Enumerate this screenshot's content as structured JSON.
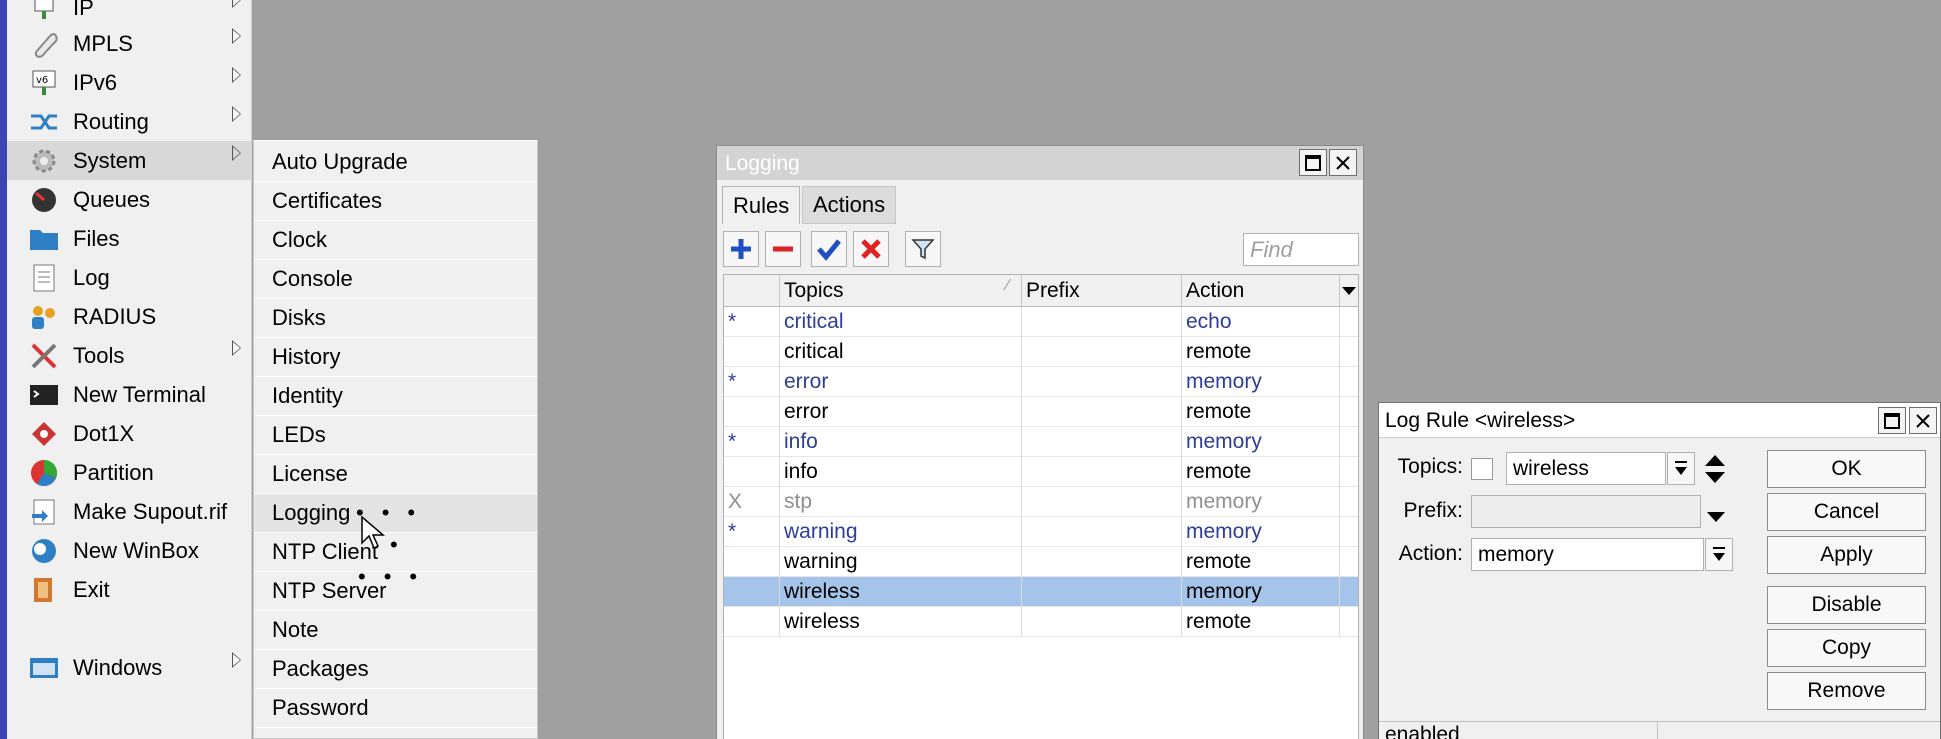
{
  "main_menu": {
    "items": [
      {
        "label": "IP",
        "icon": "ip-icon",
        "submenu": true
      },
      {
        "label": "MPLS",
        "icon": "mpls-icon",
        "submenu": true
      },
      {
        "label": "IPv6",
        "icon": "ipv6-icon",
        "submenu": true
      },
      {
        "label": "Routing",
        "icon": "routing-icon",
        "submenu": true
      },
      {
        "label": "System",
        "icon": "gear-icon",
        "submenu": true,
        "active": true
      },
      {
        "label": "Queues",
        "icon": "queues-icon",
        "submenu": false
      },
      {
        "label": "Files",
        "icon": "folder-icon",
        "submenu": false
      },
      {
        "label": "Log",
        "icon": "log-icon",
        "submenu": false
      },
      {
        "label": "RADIUS",
        "icon": "radius-icon",
        "submenu": false
      },
      {
        "label": "Tools",
        "icon": "tools-icon",
        "submenu": true
      },
      {
        "label": "New Terminal",
        "icon": "terminal-icon",
        "submenu": false
      },
      {
        "label": "Dot1X",
        "icon": "dot1x-icon",
        "submenu": false
      },
      {
        "label": "Partition",
        "icon": "partition-icon",
        "submenu": false
      },
      {
        "label": "Make Supout.rif",
        "icon": "supout-icon",
        "submenu": false
      },
      {
        "label": "New WinBox",
        "icon": "winbox-icon",
        "submenu": false
      },
      {
        "label": "Exit",
        "icon": "exit-icon",
        "submenu": false
      },
      {
        "label": "Windows",
        "icon": "windows-icon",
        "submenu": true
      }
    ]
  },
  "system_submenu": {
    "items": [
      "Auto Upgrade",
      "Certificates",
      "Clock",
      "Console",
      "Disks",
      "History",
      "Identity",
      "LEDs",
      "License",
      "Logging",
      "NTP Client",
      "NTP Server",
      "Note",
      "Packages",
      "Password"
    ],
    "active": "Logging"
  },
  "logging_window": {
    "title": "Logging",
    "tabs": [
      "Rules",
      "Actions"
    ],
    "find_placeholder": "Find",
    "columns": [
      "Topics",
      "Prefix",
      "Action"
    ],
    "rows": [
      {
        "flag": "*",
        "topics": "critical",
        "prefix": "",
        "action": "echo",
        "style": "default"
      },
      {
        "flag": "",
        "topics": "critical",
        "prefix": "",
        "action": "remote",
        "style": "normal"
      },
      {
        "flag": "*",
        "topics": "error",
        "prefix": "",
        "action": "memory",
        "style": "default"
      },
      {
        "flag": "",
        "topics": "error",
        "prefix": "",
        "action": "remote",
        "style": "normal"
      },
      {
        "flag": "*",
        "topics": "info",
        "prefix": "",
        "action": "memory",
        "style": "default"
      },
      {
        "flag": "",
        "topics": "info",
        "prefix": "",
        "action": "remote",
        "style": "normal"
      },
      {
        "flag": "X",
        "topics": "stp",
        "prefix": "",
        "action": "memory",
        "style": "disabled"
      },
      {
        "flag": "*",
        "topics": "warning",
        "prefix": "",
        "action": "memory",
        "style": "default"
      },
      {
        "flag": "",
        "topics": "warning",
        "prefix": "",
        "action": "remote",
        "style": "normal"
      },
      {
        "flag": "",
        "topics": "wireless",
        "prefix": "",
        "action": "memory",
        "style": "selected"
      },
      {
        "flag": "",
        "topics": "wireless",
        "prefix": "",
        "action": "remote",
        "style": "normal"
      }
    ]
  },
  "log_rule_dialog": {
    "title": "Log Rule <wireless>",
    "topics_label": "Topics:",
    "topics_value": "wireless",
    "prefix_label": "Prefix:",
    "prefix_value": "",
    "action_label": "Action:",
    "action_value": "memory",
    "buttons": {
      "ok": "OK",
      "cancel": "Cancel",
      "apply": "Apply",
      "disable": "Disable",
      "copy": "Copy",
      "remove": "Remove"
    },
    "status": "enabled"
  },
  "colors": {
    "accent_blue": "#3a44b5",
    "selected_row": "#a5c4ea",
    "default_rule_text": "#2d3d99",
    "disabled_rule_text": "#8f8f8f"
  }
}
